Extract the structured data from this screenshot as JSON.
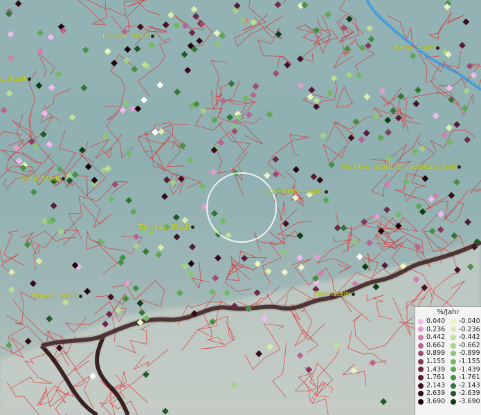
{
  "cities": [
    {
      "name": "Leipzig, Stadt"
    },
    {
      "name": "Riesa, Stadt"
    },
    {
      "name": "s, Stadt"
    },
    {
      "name": "Gera, Stadt"
    },
    {
      "name": "Chemnitz, Stadt"
    },
    {
      "name": "Freiberg, Stadt, Universitätsstadt"
    },
    {
      "name": "Zwickau, Stadt"
    },
    {
      "name": "Plauen, Stadt"
    },
    {
      "name": "Bärenstein"
    }
  ],
  "legend": {
    "title": "%/Jahr",
    "positive": [
      "0.040",
      "0.236",
      "0.442",
      "0.662",
      "0.899",
      "1.155",
      "1.439",
      "1.761",
      "2.143",
      "2.639",
      "3.690"
    ],
    "negative": [
      "-0.040",
      "-0.236",
      "-0.442",
      "-0.662",
      "-0.899",
      "-1.155",
      "-1.439",
      "-1.761",
      "-2.143",
      "-2.639",
      "-3.690"
    ],
    "positive_colors": [
      "#f2b8ef",
      "#e39bd0",
      "#d07fb0",
      "#b86593",
      "#9c4c76",
      "#823a5e",
      "#6c2a48",
      "#571c35",
      "#451224",
      "#350a19",
      "#1f040c"
    ],
    "negative_colors": [
      "#eef5b8",
      "#d9ecab",
      "#bfdf96",
      "#a5d385",
      "#8cc677",
      "#74b866",
      "#5da656",
      "#488f45",
      "#347637",
      "#1f5b28",
      "#0d3f15"
    ]
  },
  "colors": {
    "border_lines": "#e0282a",
    "water": "#4a9ed8",
    "country_border": "#2a1010"
  }
}
